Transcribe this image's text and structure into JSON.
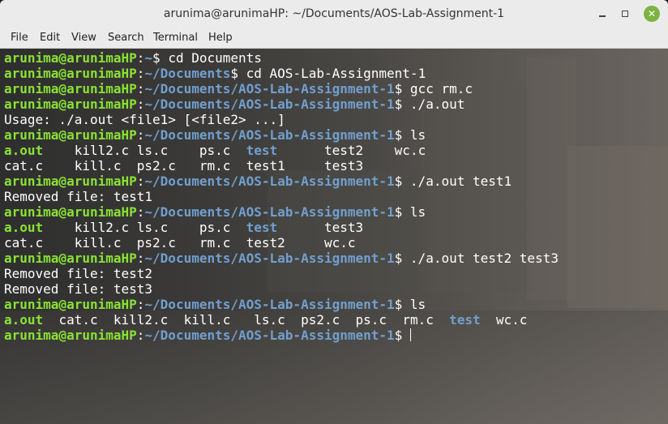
{
  "window": {
    "title": "arunima@arunimaHP: ~/Documents/AOS-Lab-Assignment-1",
    "accent_close": "#7cb342"
  },
  "menu": [
    "File",
    "Edit",
    "View",
    "Search",
    "Terminal",
    "Help"
  ],
  "prompt": {
    "user": "arunima@arunimaHP",
    "sep": ":",
    "home_path": "~",
    "docs_path": "~/Documents",
    "lab_path": "~/Documents/AOS-Lab-Assignment-1",
    "dollar": "$ "
  },
  "lines": [
    {
      "type": "prompt",
      "path": "~",
      "cmd": "cd Documents"
    },
    {
      "type": "prompt",
      "path": "~/Documents",
      "cmd": "cd AOS-Lab-Assignment-1"
    },
    {
      "type": "prompt",
      "path": "~/Documents/AOS-Lab-Assignment-1",
      "cmd": "gcc rm.c"
    },
    {
      "type": "prompt",
      "path": "~/Documents/AOS-Lab-Assignment-1",
      "cmd": "./a.out"
    },
    {
      "type": "out",
      "text": "Usage: ./a.out <file1> [<file2> ...]"
    },
    {
      "type": "prompt",
      "path": "~/Documents/AOS-Lab-Assignment-1",
      "cmd": "ls"
    },
    {
      "type": "ls",
      "cols": [
        {
          "t": "a.out",
          "k": "exe"
        },
        {
          "t": "kill2.c"
        },
        {
          "t": "ls.c"
        },
        {
          "t": "ps.c"
        },
        {
          "t": "test",
          "k": "dir"
        },
        {
          "t": "test2"
        },
        {
          "t": "wc.c"
        }
      ],
      "widths": [
        9,
        8,
        8,
        6,
        10,
        9,
        4
      ]
    },
    {
      "type": "ls",
      "cols": [
        {
          "t": "cat.c"
        },
        {
          "t": "kill.c"
        },
        {
          "t": "ps2.c"
        },
        {
          "t": "rm.c"
        },
        {
          "t": "test1"
        },
        {
          "t": "test3"
        }
      ],
      "widths": [
        9,
        8,
        8,
        6,
        10,
        5
      ]
    },
    {
      "type": "prompt",
      "path": "~/Documents/AOS-Lab-Assignment-1",
      "cmd": "./a.out test1"
    },
    {
      "type": "out",
      "text": "Removed file: test1"
    },
    {
      "type": "prompt",
      "path": "~/Documents/AOS-Lab-Assignment-1",
      "cmd": "ls"
    },
    {
      "type": "ls",
      "cols": [
        {
          "t": "a.out",
          "k": "exe"
        },
        {
          "t": "kill2.c"
        },
        {
          "t": "ls.c"
        },
        {
          "t": "ps.c"
        },
        {
          "t": "test",
          "k": "dir"
        },
        {
          "t": "test3"
        }
      ],
      "widths": [
        9,
        8,
        8,
        6,
        10,
        5
      ]
    },
    {
      "type": "ls",
      "cols": [
        {
          "t": "cat.c"
        },
        {
          "t": "kill.c"
        },
        {
          "t": "ps2.c"
        },
        {
          "t": "rm.c"
        },
        {
          "t": "test2"
        },
        {
          "t": "wc.c"
        }
      ],
      "widths": [
        9,
        8,
        8,
        6,
        10,
        4
      ]
    },
    {
      "type": "prompt",
      "path": "~/Documents/AOS-Lab-Assignment-1",
      "cmd": "./a.out test2 test3"
    },
    {
      "type": "out",
      "text": "Removed file: test2"
    },
    {
      "type": "out",
      "text": "Removed file: test3"
    },
    {
      "type": "prompt",
      "path": "~/Documents/AOS-Lab-Assignment-1",
      "cmd": "ls"
    },
    {
      "type": "ls",
      "cols": [
        {
          "t": "a.out",
          "k": "exe"
        },
        {
          "t": "cat.c"
        },
        {
          "t": "kill2.c"
        },
        {
          "t": "kill.c"
        },
        {
          "t": "ls.c"
        },
        {
          "t": "ps2.c"
        },
        {
          "t": "ps.c"
        },
        {
          "t": "rm.c"
        },
        {
          "t": "test",
          "k": "dir"
        },
        {
          "t": "wc.c"
        }
      ],
      "widths": [
        7,
        7,
        9,
        9,
        6,
        7,
        6,
        6,
        6,
        4
      ]
    },
    {
      "type": "prompt",
      "path": "~/Documents/AOS-Lab-Assignment-1",
      "cmd": "",
      "cursor": true
    }
  ],
  "colors": {
    "user": "#8ae234",
    "path": "#729fcf",
    "exe": "#8ae234",
    "dir": "#729fcf",
    "text": "#ffffff"
  }
}
